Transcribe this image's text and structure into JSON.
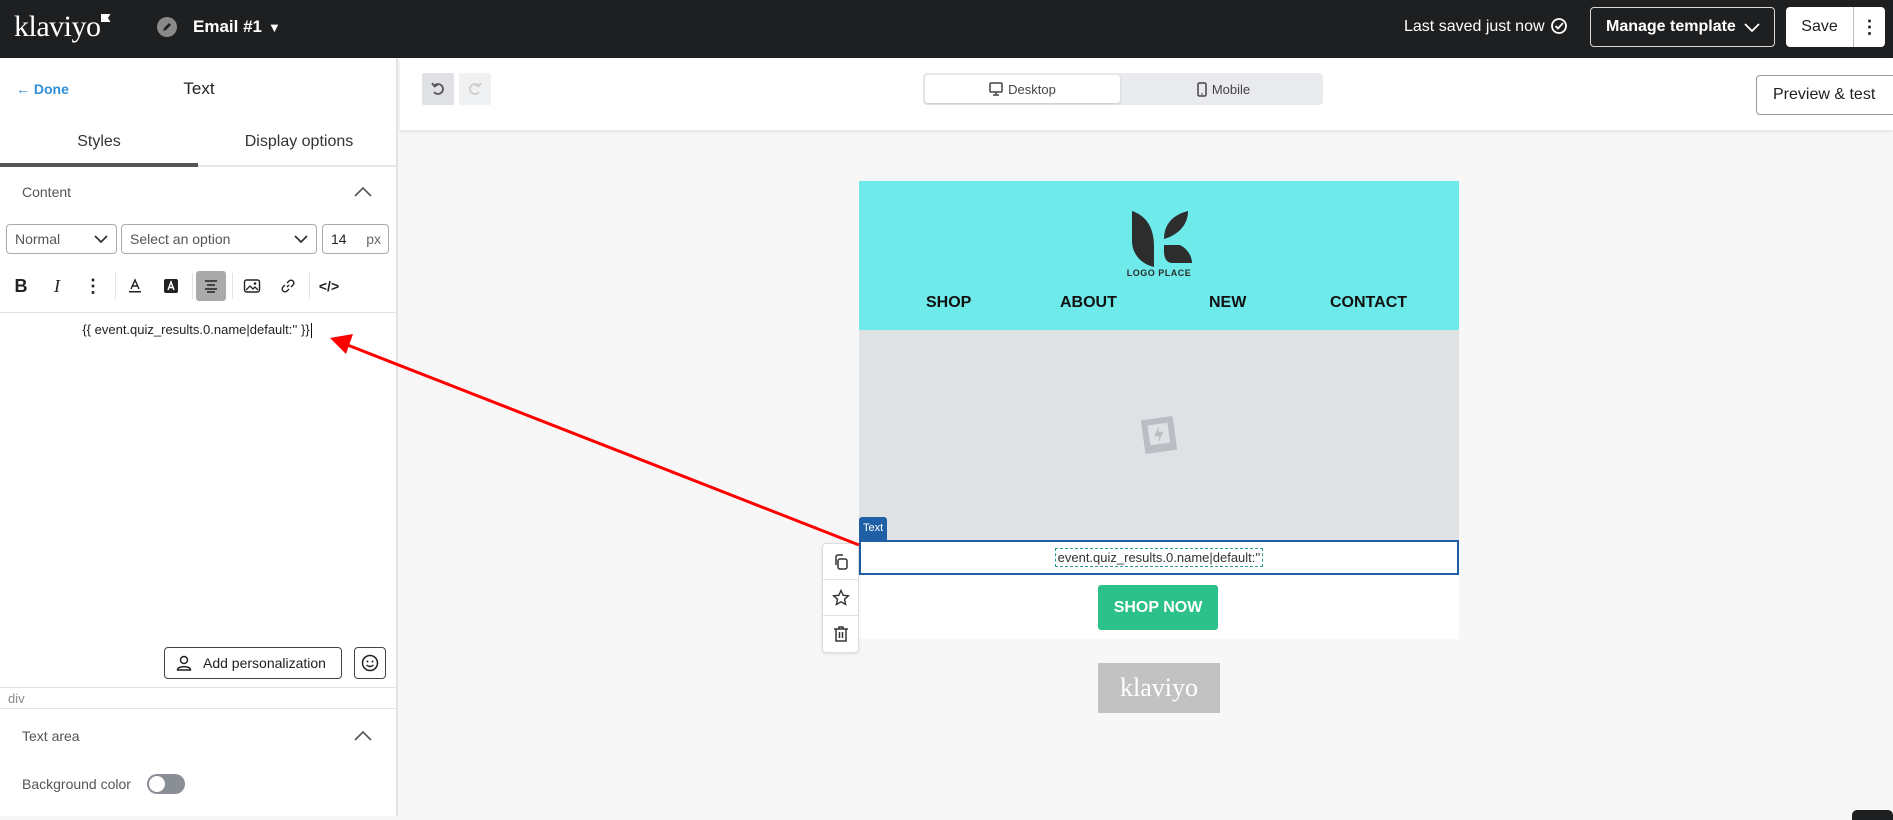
{
  "topbar": {
    "logo": "klaviyo",
    "email_title": "Email #1",
    "saved_status": "Last saved just now",
    "manage_template_label": "Manage template",
    "save_label": "Save"
  },
  "sidebar": {
    "done_label": "Done",
    "panel_title": "Text",
    "tabs": [
      {
        "label": "Styles",
        "active": true
      },
      {
        "label": "Display options",
        "active": false
      }
    ],
    "content_section": "Content",
    "format_select": "Normal",
    "font_select_placeholder": "Select an option",
    "font_size": "14",
    "font_size_unit": "px",
    "toolbar": [
      "bold",
      "italic",
      "more",
      "text-color",
      "highlight-color",
      "align-center",
      "image",
      "link",
      "source-code"
    ],
    "editor_text": "{{ event.quiz_results.0.name|default:'' }}",
    "add_personalization_label": "Add personalization",
    "element_path": "div",
    "text_area_section": "Text area",
    "background_color_label": "Background color",
    "background_color_enabled": false
  },
  "canvas": {
    "device_options": [
      {
        "label": "Desktop",
        "active": true
      },
      {
        "label": "Mobile",
        "active": false
      }
    ],
    "preview_label": "Preview & test",
    "email": {
      "header_bg": "#6eeaea",
      "brand_text": "LOGO PLACE",
      "nav": [
        "SHOP",
        "ABOUT",
        "NEW",
        "CONTACT"
      ],
      "selected_block_tag": "Text",
      "merge_text": "event.quiz_results.0.name|default:''",
      "cta_label": "SHOP NOW",
      "cta_color": "#2cc18a",
      "footer_logo": "klaviyo"
    }
  },
  "colors": {
    "topbar": "#1e1f21",
    "accent_link": "#2f8fd8",
    "selection": "#1f5fa5",
    "annotation_arrow": "#ff0000"
  }
}
